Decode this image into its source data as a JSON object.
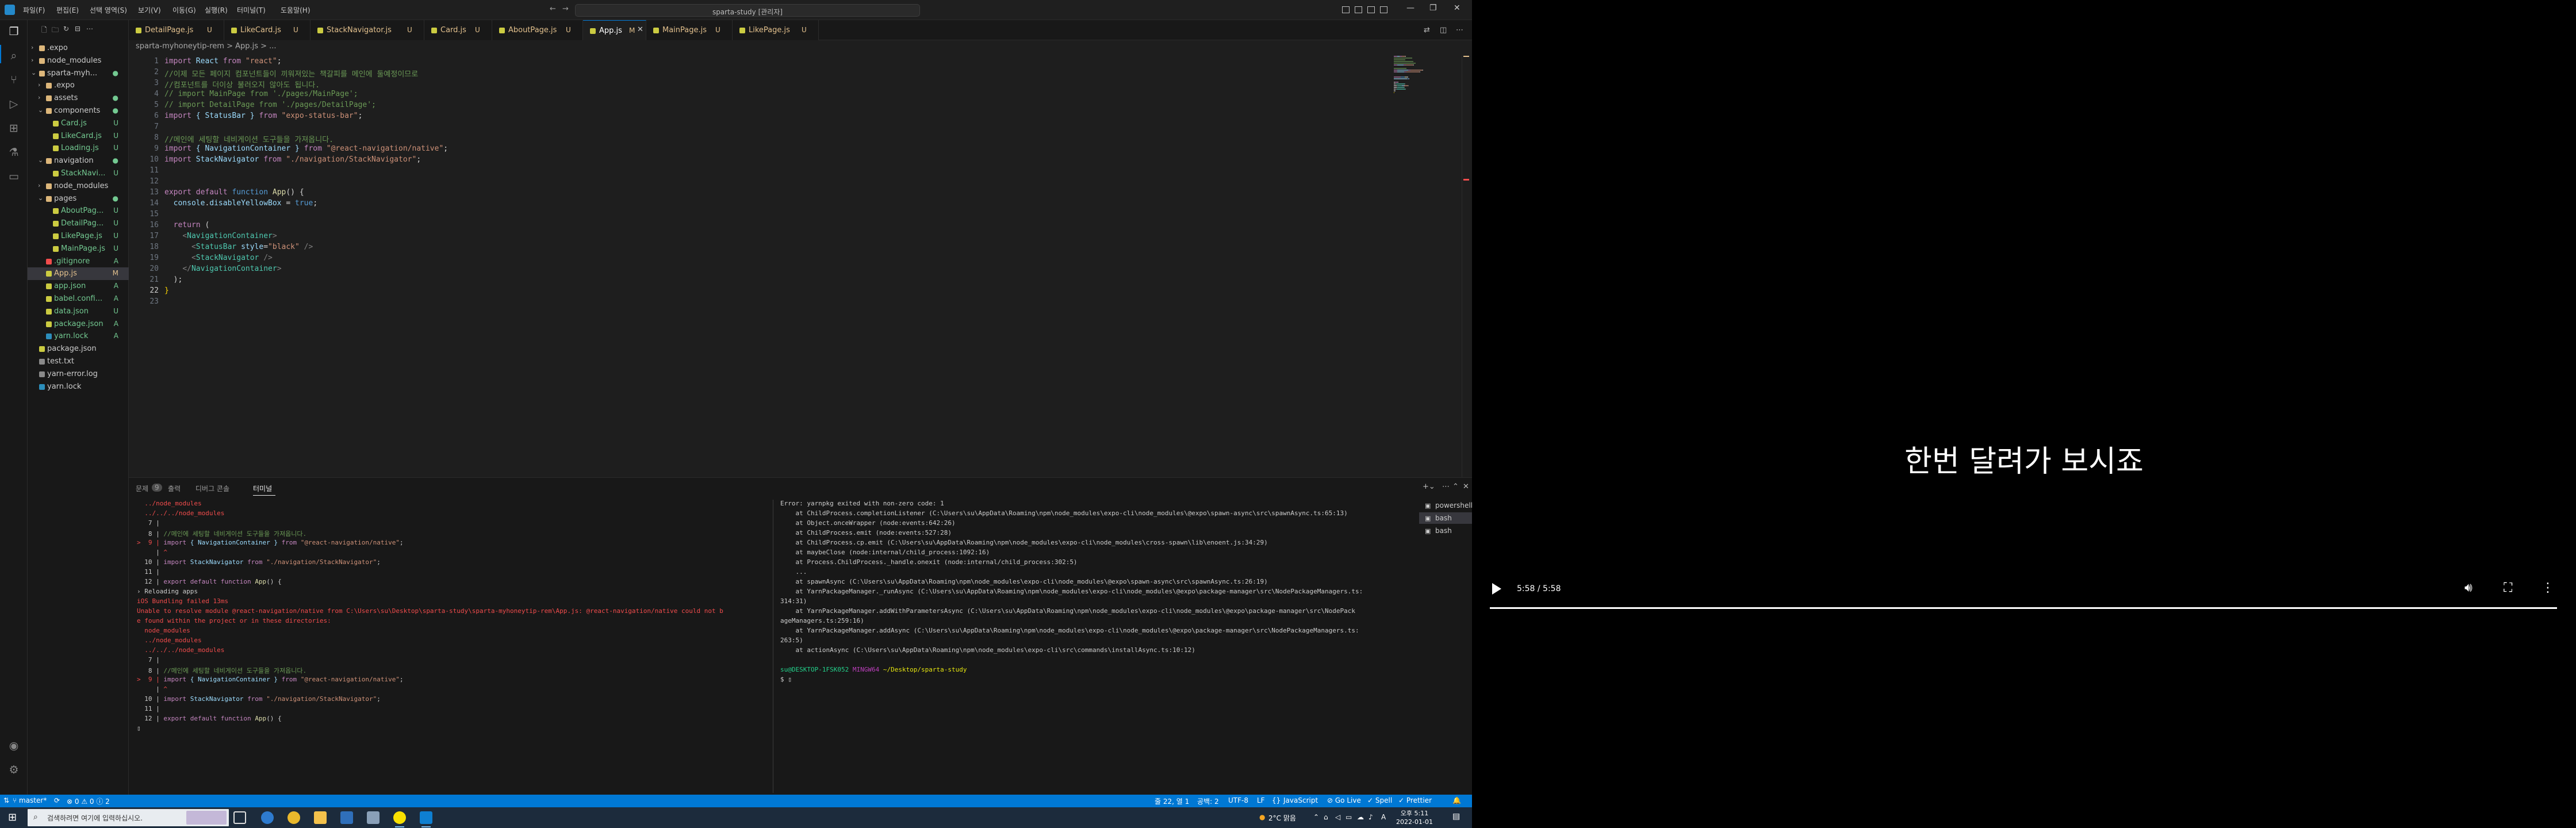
{
  "window": {
    "title": "sparta-study [관리자]"
  },
  "menu": [
    "파일(F)",
    "편집(E)",
    "선택 영역(S)",
    "보기(V)",
    "이동(G)",
    "실행(R)",
    "터미널(T)",
    "도움말(H)"
  ],
  "explorer": {
    "rows": [
      {
        "name": ".expo",
        "kind": "folder",
        "depth": 0,
        "open": false,
        "badge": ""
      },
      {
        "name": "node_modules",
        "kind": "folder",
        "depth": 0,
        "open": false,
        "badge": ""
      },
      {
        "name": "sparta-myh...",
        "kind": "folder",
        "depth": 0,
        "open": true,
        "badge": "●"
      },
      {
        "name": ".expo",
        "kind": "folder",
        "depth": 1,
        "open": false,
        "badge": ""
      },
      {
        "name": "assets",
        "kind": "folder",
        "depth": 1,
        "open": false,
        "badge": "●"
      },
      {
        "name": "components",
        "kind": "folder",
        "depth": 1,
        "open": true,
        "badge": "●"
      },
      {
        "name": "Card.js",
        "kind": "js",
        "depth": 2,
        "open": false,
        "badge": "U"
      },
      {
        "name": "LikeCard.js",
        "kind": "js",
        "depth": 2,
        "open": false,
        "badge": "U"
      },
      {
        "name": "Loading.js",
        "kind": "js",
        "depth": 2,
        "open": false,
        "badge": "U"
      },
      {
        "name": "navigation",
        "kind": "folder",
        "depth": 1,
        "open": true,
        "badge": "●"
      },
      {
        "name": "StackNavi...",
        "kind": "js",
        "depth": 2,
        "open": false,
        "badge": "U"
      },
      {
        "name": "node_modules",
        "kind": "folder",
        "depth": 1,
        "open": false,
        "badge": ""
      },
      {
        "name": "pages",
        "kind": "folder",
        "depth": 1,
        "open": true,
        "badge": "●"
      },
      {
        "name": "AboutPag...",
        "kind": "js",
        "depth": 2,
        "open": false,
        "badge": "U"
      },
      {
        "name": "DetailPag...",
        "kind": "js",
        "depth": 2,
        "open": false,
        "badge": "U"
      },
      {
        "name": "LikePage.js",
        "kind": "js",
        "depth": 2,
        "open": false,
        "badge": "U"
      },
      {
        "name": "MainPage.js",
        "kind": "js",
        "depth": 2,
        "open": false,
        "badge": "U"
      },
      {
        "name": ".gitignore",
        "kind": "git",
        "depth": 1,
        "open": false,
        "badge": "A"
      },
      {
        "name": "App.js",
        "kind": "js",
        "depth": 1,
        "open": false,
        "badge": "M",
        "selected": true
      },
      {
        "name": "app.json",
        "kind": "json",
        "depth": 1,
        "open": false,
        "badge": "A"
      },
      {
        "name": "babel.confi...",
        "kind": "js",
        "depth": 1,
        "open": false,
        "badge": "A"
      },
      {
        "name": "data.json",
        "kind": "json",
        "depth": 1,
        "open": false,
        "badge": "U"
      },
      {
        "name": "package.json",
        "kind": "json",
        "depth": 1,
        "open": false,
        "badge": "A"
      },
      {
        "name": "yarn.lock",
        "kind": "yarn",
        "depth": 1,
        "open": false,
        "badge": "A"
      },
      {
        "name": "package.json",
        "kind": "json",
        "depth": 0,
        "open": false,
        "badge": ""
      },
      {
        "name": "test.txt",
        "kind": "txt",
        "depth": 0,
        "open": false,
        "badge": ""
      },
      {
        "name": "yarn-error.log",
        "kind": "txt",
        "depth": 0,
        "open": false,
        "badge": ""
      },
      {
        "name": "yarn.lock",
        "kind": "yarn",
        "depth": 0,
        "open": false,
        "badge": ""
      }
    ]
  },
  "tabs": [
    {
      "label": "DetailPage.js",
      "status": "U",
      "active": false
    },
    {
      "label": "LikeCard.js",
      "status": "U",
      "active": false
    },
    {
      "label": "StackNavigator.js",
      "status": "U",
      "active": false
    },
    {
      "label": "Card.js",
      "status": "U",
      "active": false
    },
    {
      "label": "AboutPage.js",
      "status": "U",
      "active": false
    },
    {
      "label": "App.js",
      "status": "M",
      "active": true
    },
    {
      "label": "MainPage.js",
      "status": "U",
      "active": false
    },
    {
      "label": "LikePage.js",
      "status": "U",
      "active": false
    }
  ],
  "breadcrumb": "sparta-myhoneytip-rem > App.js > ...",
  "code": [
    [
      [
        "import ",
        "#c586c0"
      ],
      [
        "React ",
        "#9cdcfe"
      ],
      [
        "from ",
        "#c586c0"
      ],
      [
        "\"react\"",
        "#ce9178"
      ],
      [
        ";",
        "#d4d4d4"
      ]
    ],
    [
      [
        "//이제 모든 페이지 컴포넌트들이 끼워져있는 책갈피를 메인에 둘예정이므로",
        "#6a9955"
      ]
    ],
    [
      [
        "//컴포넌트를 더이상 불러오지 않아도 됩니다.",
        "#6a9955"
      ]
    ],
    [
      [
        "// import MainPage from './pages/MainPage';",
        "#6a9955"
      ]
    ],
    [
      [
        "// import DetailPage from './pages/DetailPage';",
        "#6a9955"
      ]
    ],
    [
      [
        "import ",
        "#c586c0"
      ],
      [
        "{ StatusBar } ",
        "#9cdcfe"
      ],
      [
        "from ",
        "#c586c0"
      ],
      [
        "\"expo-status-bar\"",
        "#ce9178"
      ],
      [
        ";",
        "#d4d4d4"
      ]
    ],
    [
      [
        "",
        "#d4d4d4"
      ]
    ],
    [
      [
        "//메인에 세팅할 네비게이션 도구들을 가져옵니다.",
        "#6a9955"
      ]
    ],
    [
      [
        "import ",
        "#c586c0"
      ],
      [
        "{ NavigationContainer } ",
        "#9cdcfe"
      ],
      [
        "from ",
        "#c586c0"
      ],
      [
        "\"@react-navigation/native\"",
        "#ce9178"
      ],
      [
        ";",
        "#d4d4d4"
      ]
    ],
    [
      [
        "import ",
        "#c586c0"
      ],
      [
        "StackNavigator ",
        "#9cdcfe"
      ],
      [
        "from ",
        "#c586c0"
      ],
      [
        "\"./navigation/StackNavigator\"",
        "#ce9178"
      ],
      [
        ";",
        "#d4d4d4"
      ]
    ],
    [
      [
        "",
        "#d4d4d4"
      ]
    ],
    [
      [
        "",
        "#d4d4d4"
      ]
    ],
    [
      [
        "export ",
        "#c586c0"
      ],
      [
        "default ",
        "#c586c0"
      ],
      [
        "function ",
        "#569cd6"
      ],
      [
        "App",
        "#dcdcaa"
      ],
      [
        "() {",
        "#d4d4d4"
      ]
    ],
    [
      [
        "  console",
        "#9cdcfe"
      ],
      [
        ".",
        "#d4d4d4"
      ],
      [
        "disableYellowBox ",
        "#9cdcfe"
      ],
      [
        "= ",
        "#d4d4d4"
      ],
      [
        "true",
        "#569cd6"
      ],
      [
        ";",
        "#d4d4d4"
      ]
    ],
    [
      [
        "",
        "#d4d4d4"
      ]
    ],
    [
      [
        "  ",
        "#d4d4d4"
      ],
      [
        "return ",
        "#c586c0"
      ],
      [
        "(",
        "#d4d4d4"
      ]
    ],
    [
      [
        "    ",
        "#d4d4d4"
      ],
      [
        "<",
        "#808080"
      ],
      [
        "NavigationContainer",
        "#4ec9b0"
      ],
      [
        ">",
        "#808080"
      ]
    ],
    [
      [
        "      ",
        "#d4d4d4"
      ],
      [
        "<",
        "#808080"
      ],
      [
        "StatusBar ",
        "#4ec9b0"
      ],
      [
        "style",
        "#9cdcfe"
      ],
      [
        "=",
        "#d4d4d4"
      ],
      [
        "\"black\" ",
        "#ce9178"
      ],
      [
        "/>",
        "#808080"
      ]
    ],
    [
      [
        "      ",
        "#d4d4d4"
      ],
      [
        "<",
        "#808080"
      ],
      [
        "StackNavigator ",
        "#4ec9b0"
      ],
      [
        "/>",
        "#808080"
      ]
    ],
    [
      [
        "    ",
        "#d4d4d4"
      ],
      [
        "</",
        "#808080"
      ],
      [
        "NavigationContainer",
        "#4ec9b0"
      ],
      [
        ">",
        "#808080"
      ]
    ],
    [
      [
        "  );",
        "#d4d4d4"
      ]
    ],
    [
      [
        "}",
        "#ffd700"
      ]
    ],
    [
      [
        "",
        "#d4d4d4"
      ]
    ]
  ],
  "panel": {
    "tabs": [
      {
        "label": "문제",
        "count": "9",
        "active": false
      },
      {
        "label": "출력",
        "count": "",
        "active": false
      },
      {
        "label": "디버그 콘솔",
        "count": "",
        "active": false
      },
      {
        "label": "터미널",
        "count": "",
        "active": true
      }
    ],
    "terminals": [
      {
        "label": "powershell",
        "icon": "▣",
        "selected": false
      },
      {
        "label": "bash",
        "icon": "▣",
        "selected": true
      },
      {
        "label": "bash",
        "icon": "▣",
        "selected": false
      }
    ]
  },
  "terminal_left": [
    [
      [
        "  ../node_modules",
        "#f14c4c"
      ]
    ],
    [
      [
        "  ../../../node_modules",
        "#f14c4c"
      ]
    ],
    [
      [
        "   7 |",
        "#cccccc"
      ]
    ],
    [
      [
        "   8 | ",
        "#cccccc"
      ],
      [
        "//메인에 세팅할 네비게이션 도구들을 가져옵니다.",
        "#6a9955"
      ]
    ],
    [
      [
        ">  9 | ",
        "#f14c4c"
      ],
      [
        "import ",
        "#c586c0"
      ],
      [
        "{ NavigationContainer } ",
        "#9cdcfe"
      ],
      [
        "from ",
        "#c586c0"
      ],
      [
        "\"@react-navigation/native\"",
        "#ce9178"
      ],
      [
        ";",
        "#cccccc"
      ]
    ],
    [
      [
        "     | ",
        "#cccccc"
      ],
      [
        "^",
        "#f14c4c"
      ]
    ],
    [
      [
        "  10 | ",
        "#cccccc"
      ],
      [
        "import ",
        "#c586c0"
      ],
      [
        "StackNavigator ",
        "#9cdcfe"
      ],
      [
        "from ",
        "#c586c0"
      ],
      [
        "\"./navigation/StackNavigator\"",
        "#ce9178"
      ],
      [
        ";",
        "#cccccc"
      ]
    ],
    [
      [
        "  11 |",
        "#cccccc"
      ]
    ],
    [
      [
        "  12 | ",
        "#cccccc"
      ],
      [
        "export default function ",
        "#c586c0"
      ],
      [
        "App",
        "#dcdcaa"
      ],
      [
        "() {",
        "#cccccc"
      ]
    ],
    [
      [
        "› Reloading apps",
        "#cccccc"
      ]
    ],
    [
      [
        "iOS Bundling failed 13ms",
        "#f14c4c"
      ]
    ],
    [
      [
        "Unable to resolve module @react-navigation/native from C:\\Users\\su\\Desktop\\sparta-study\\sparta-myhoneytip-rem\\App.js: @react-navigation/native could not b",
        "#f14c4c"
      ]
    ],
    [
      [
        "e found within the project or in these directories:",
        "#f14c4c"
      ]
    ],
    [
      [
        "  node_modules",
        "#f14c4c"
      ]
    ],
    [
      [
        "  ../node_modules",
        "#f14c4c"
      ]
    ],
    [
      [
        "  ../../../node_modules",
        "#f14c4c"
      ]
    ],
    [
      [
        "   7 |",
        "#cccccc"
      ]
    ],
    [
      [
        "   8 | ",
        "#cccccc"
      ],
      [
        "//메인에 세팅할 네비게이션 도구들을 가져옵니다.",
        "#6a9955"
      ]
    ],
    [
      [
        ">  9 | ",
        "#f14c4c"
      ],
      [
        "import ",
        "#c586c0"
      ],
      [
        "{ NavigationContainer } ",
        "#9cdcfe"
      ],
      [
        "from ",
        "#c586c0"
      ],
      [
        "\"@react-navigation/native\"",
        "#ce9178"
      ],
      [
        ";",
        "#cccccc"
      ]
    ],
    [
      [
        "     | ",
        "#cccccc"
      ],
      [
        "^",
        "#f14c4c"
      ]
    ],
    [
      [
        "  10 | ",
        "#cccccc"
      ],
      [
        "import ",
        "#c586c0"
      ],
      [
        "StackNavigator ",
        "#9cdcfe"
      ],
      [
        "from ",
        "#c586c0"
      ],
      [
        "\"./navigation/StackNavigator\"",
        "#ce9178"
      ],
      [
        ";",
        "#cccccc"
      ]
    ],
    [
      [
        "  11 |",
        "#cccccc"
      ]
    ],
    [
      [
        "  12 | ",
        "#cccccc"
      ],
      [
        "export default function ",
        "#c586c0"
      ],
      [
        "App",
        "#dcdcaa"
      ],
      [
        "() {",
        "#cccccc"
      ]
    ],
    [
      [
        "▯",
        "#cccccc"
      ]
    ]
  ],
  "terminal_right": [
    [
      [
        "Error: yarnpkg exited with non-zero code: 1",
        "#cccccc"
      ]
    ],
    [
      [
        "    at ChildProcess.completionListener (C:\\Users\\su\\AppData\\Roaming\\npm\\node_modules\\expo-cli\\node_modules\\@expo\\spawn-async\\src\\spawnAsync.ts:65:13)",
        "#cccccc"
      ]
    ],
    [
      [
        "    at Object.onceWrapper (node:events:642:26)",
        "#cccccc"
      ]
    ],
    [
      [
        "    at ChildProcess.emit (node:events:527:28)",
        "#cccccc"
      ]
    ],
    [
      [
        "    at ChildProcess.cp.emit (C:\\Users\\su\\AppData\\Roaming\\npm\\node_modules\\expo-cli\\node_modules\\cross-spawn\\lib\\enoent.js:34:29)",
        "#cccccc"
      ]
    ],
    [
      [
        "    at maybeClose (node:internal/child_process:1092:16)",
        "#cccccc"
      ]
    ],
    [
      [
        "    at Process.ChildProcess._handle.onexit (node:internal/child_process:302:5)",
        "#cccccc"
      ]
    ],
    [
      [
        "    ...",
        "#cccccc"
      ]
    ],
    [
      [
        "    at spawnAsync (C:\\Users\\su\\AppData\\Roaming\\npm\\node_modules\\expo-cli\\node_modules\\@expo\\spawn-async\\src\\spawnAsync.ts:26:19)",
        "#cccccc"
      ]
    ],
    [
      [
        "    at YarnPackageManager._runAsync (C:\\Users\\su\\AppData\\Roaming\\npm\\node_modules\\expo-cli\\node_modules\\@expo\\package-manager\\src\\NodePackageManagers.ts:",
        "#cccccc"
      ]
    ],
    [
      [
        "314:31)",
        "#cccccc"
      ]
    ],
    [
      [
        "    at YarnPackageManager.addWithParametersAsync (C:\\Users\\su\\AppData\\Roaming\\npm\\node_modules\\expo-cli\\node_modules\\@expo\\package-manager\\src\\NodePack",
        "#cccccc"
      ]
    ],
    [
      [
        "ageManagers.ts:259:16)",
        "#cccccc"
      ]
    ],
    [
      [
        "    at YarnPackageManager.addAsync (C:\\Users\\su\\AppData\\Roaming\\npm\\node_modules\\expo-cli\\node_modules\\@expo\\package-manager\\src\\NodePackageManagers.ts:",
        "#cccccc"
      ]
    ],
    [
      [
        "263:5)",
        "#cccccc"
      ]
    ],
    [
      [
        "    at actionAsync (C:\\Users\\su\\AppData\\Roaming\\npm\\node_modules\\expo-cli\\src\\commands\\installAsync.ts:10:12)",
        "#cccccc"
      ]
    ],
    [
      [
        "",
        "#cccccc"
      ]
    ],
    [
      [
        "su@DESKTOP-1FSK052 ",
        "#23d18b"
      ],
      [
        "MINGW64 ",
        "#bc3fbc"
      ],
      [
        "~/Desktop/sparta-study",
        "#e5e510"
      ]
    ],
    [
      [
        "$ ▯",
        "#cccccc"
      ]
    ]
  ],
  "statusbar": {
    "branch": "master*",
    "sync": "⟳",
    "problems": "⊗ 0 ⚠ 0 ⓘ 2",
    "position": "줄 22, 열 1",
    "spaces": "공백: 2",
    "encoding": "UTF-8",
    "eol": "LF",
    "braces": "{}",
    "language": "JavaScript",
    "golive": "⊘ Go Live",
    "spell": "✓ Spell",
    "prettier": "✓ Prettier",
    "bell": "🔔"
  },
  "taskbar": {
    "search_placeholder": "검색하려면 여기에 입력하십시오.",
    "weather": "2°C 맑음",
    "ime": "A",
    "time": "오후 5:11",
    "date": "2022-01-01"
  },
  "video": {
    "subtitle": "한번 달려가 보시죠",
    "time": "5:58 / 5:58",
    "progress": 1.0
  },
  "colors": {
    "accent": "#0078d4",
    "untracked": "#73c991",
    "modified": "#e2c08d",
    "error": "#f14c4c"
  }
}
